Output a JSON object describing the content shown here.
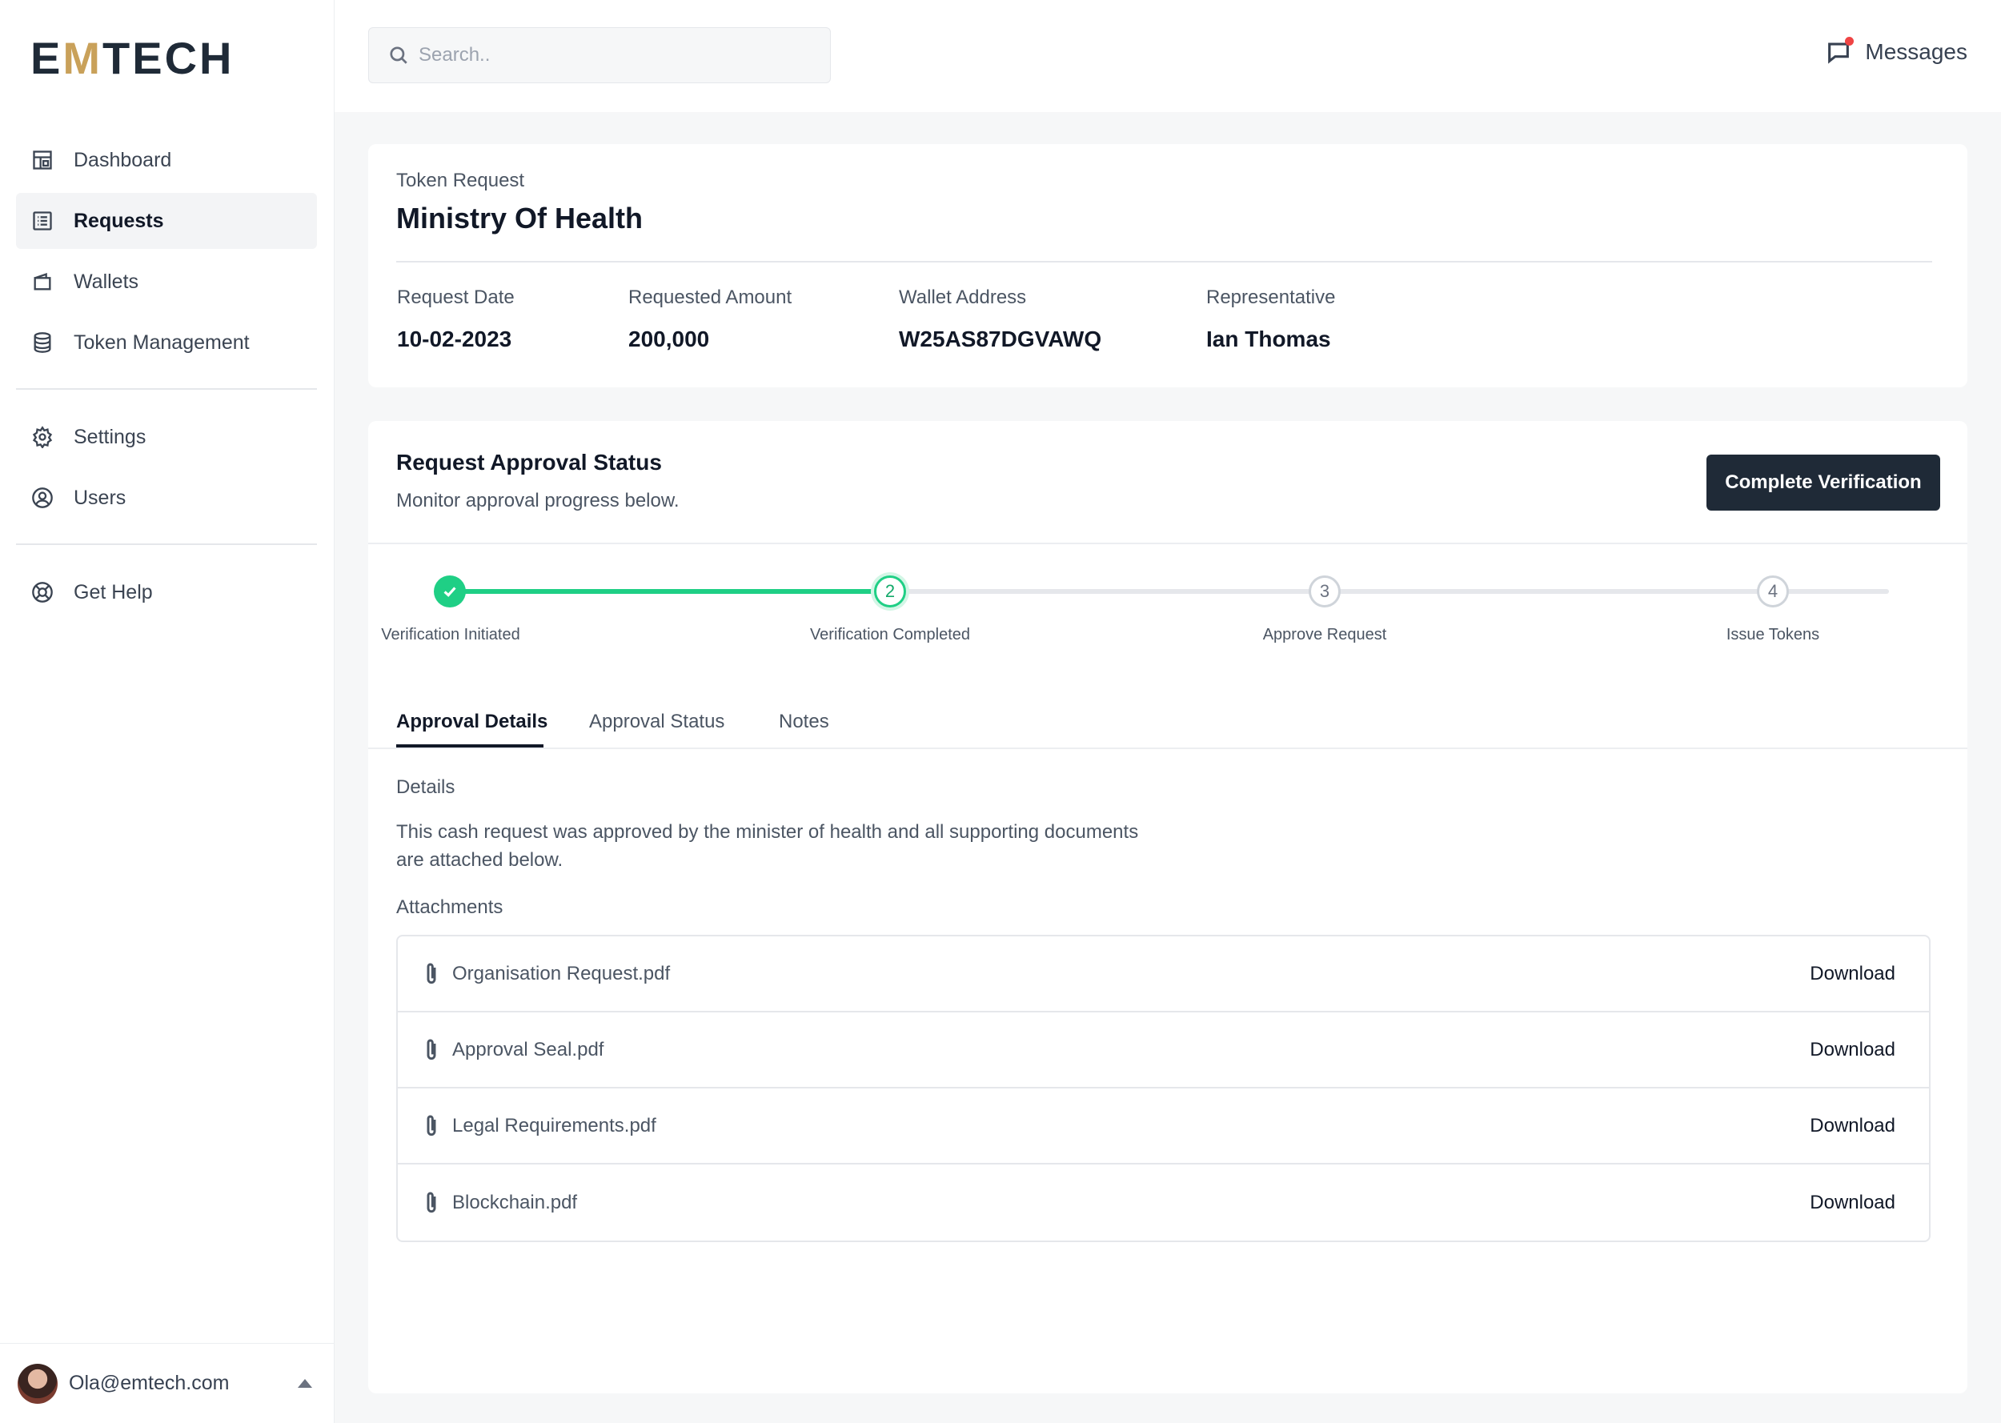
{
  "brand": {
    "logo_left": "E",
    "logo_accent": "M",
    "logo_right": "TECH",
    "accent_color": "#c9a15a"
  },
  "sidebar": {
    "items": [
      {
        "label": "Dashboard",
        "icon": "dashboard-icon"
      },
      {
        "label": "Requests",
        "icon": "list-icon",
        "active": true
      },
      {
        "label": "Wallets",
        "icon": "wallet-icon"
      },
      {
        "label": "Token Management",
        "icon": "database-icon"
      }
    ],
    "items2": [
      {
        "label": "Settings",
        "icon": "gear-icon"
      },
      {
        "label": "Users",
        "icon": "user-circle-icon"
      }
    ],
    "items3": [
      {
        "label": "Get Help",
        "icon": "lifebuoy-icon"
      }
    ],
    "user_email": "Ola@emtech.com"
  },
  "topbar": {
    "search_placeholder": "Search..",
    "messages_label": "Messages"
  },
  "request": {
    "kicker": "Token Request",
    "name": "Ministry Of Health",
    "meta": [
      {
        "label": "Request Date",
        "value": "10-02-2023"
      },
      {
        "label": "Requested Amount",
        "value": "200,000"
      },
      {
        "label": "Wallet Address",
        "value": "W25AS87DGVAWQ"
      },
      {
        "label": "Representative",
        "value": "Ian Thomas"
      }
    ]
  },
  "approval": {
    "title": "Request Approval Status",
    "subtitle": "Monitor approval progress below.",
    "button_label": "Complete Verification",
    "steps": [
      {
        "number": "1",
        "label": "Verification Initiated",
        "state": "done"
      },
      {
        "number": "2",
        "label": "Verification Completed",
        "state": "current"
      },
      {
        "number": "3",
        "label": "Approve Request",
        "state": "pending"
      },
      {
        "number": "4",
        "label": "Issue Tokens",
        "state": "pending"
      }
    ],
    "progress_color": "#1fcf85",
    "tabs": [
      "Approval Details",
      "Approval Status",
      "Notes"
    ],
    "details_heading": "Details",
    "details_text": "This cash request was approved by the minister of health and all supporting documents are attached below.",
    "attachments_heading": "Attachments",
    "attachments": [
      {
        "name": "Organisation Request.pdf",
        "action": "Download"
      },
      {
        "name": "Approval Seal.pdf",
        "action": "Download"
      },
      {
        "name": "Legal Requirements.pdf",
        "action": "Download"
      },
      {
        "name": "Blockchain.pdf",
        "action": "Download"
      }
    ]
  }
}
